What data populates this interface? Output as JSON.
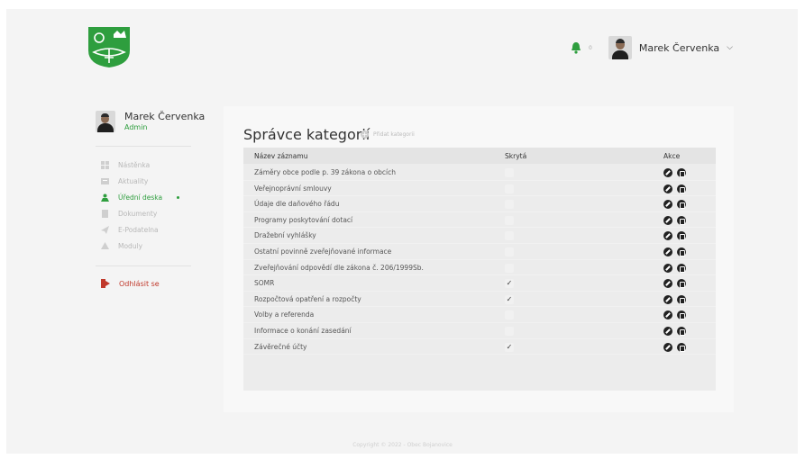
{
  "header": {
    "username": "Marek Červenka",
    "notification_count": "0",
    "colors": {
      "accent_green": "#2e9e3e"
    }
  },
  "sidebar": {
    "user": {
      "name": "Marek Červenka",
      "role": "Admin"
    },
    "items": [
      {
        "label": "Nástěnka",
        "icon": "dashboard-icon",
        "active": false
      },
      {
        "label": "Aktuality",
        "icon": "news-icon",
        "active": false
      },
      {
        "label": "Úřední deska",
        "icon": "board-icon",
        "active": true
      },
      {
        "label": "Dokumenty",
        "icon": "document-icon",
        "active": false
      },
      {
        "label": "E-Podatelna",
        "icon": "send-icon",
        "active": false
      },
      {
        "label": "Moduly",
        "icon": "modules-icon",
        "active": false
      }
    ],
    "logout_label": "Odhlásit se"
  },
  "main": {
    "title": "Správce kategorií",
    "add_label": "Přidat kategorii",
    "table": {
      "headers": [
        "Název záznamu",
        "Skrytá",
        "Akce"
      ],
      "rows": [
        {
          "name": "Záměry obce podle p. 39 zákona o obcích",
          "hidden": false
        },
        {
          "name": "Veřejnoprávní smlouvy",
          "hidden": false
        },
        {
          "name": "Údaje dle daňového řádu",
          "hidden": false
        },
        {
          "name": "Programy poskytování dotací",
          "hidden": false
        },
        {
          "name": "Dražební vyhlášky",
          "hidden": false
        },
        {
          "name": "Ostatní povinně zveřejňované informace",
          "hidden": false
        },
        {
          "name": "Zveřejňování odpovědí dle zákona č. 206/1999Sb.",
          "hidden": false
        },
        {
          "name": "SOMR",
          "hidden": true
        },
        {
          "name": "Rozpočtová opatření a rozpočty",
          "hidden": true
        },
        {
          "name": "Volby a referenda",
          "hidden": false
        },
        {
          "name": "Informace o konání zasedání",
          "hidden": false
        },
        {
          "name": "Závěrečné účty",
          "hidden": true
        }
      ]
    }
  },
  "footer": {
    "copyright": "Copyright © 2022 - Obec Bojanovice"
  }
}
